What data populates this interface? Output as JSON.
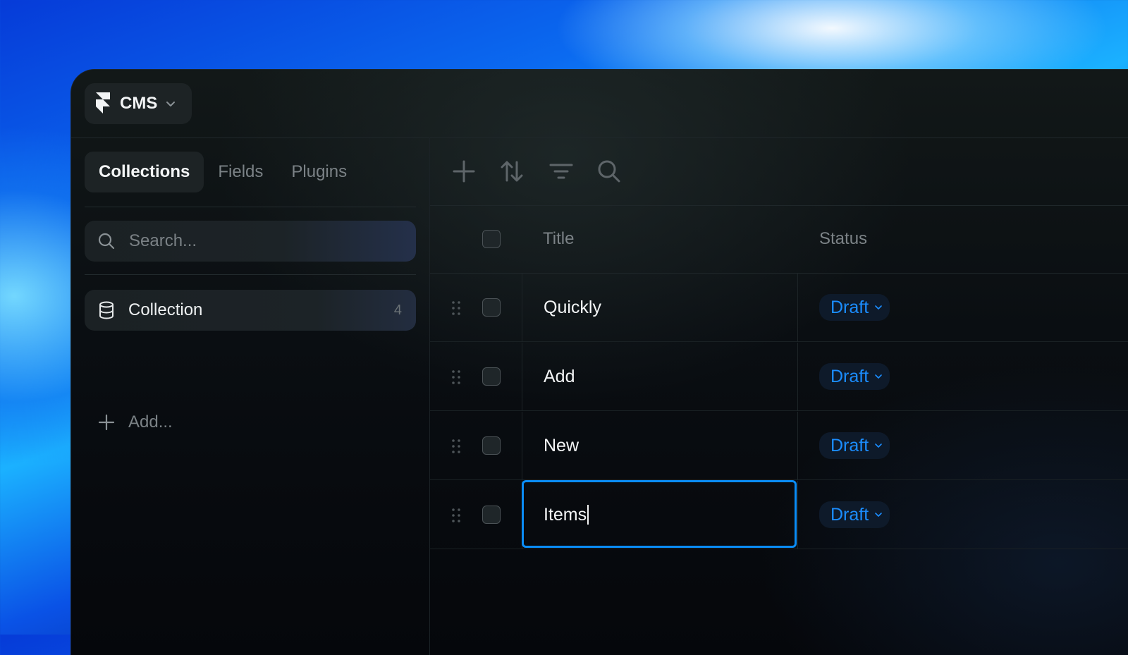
{
  "app": {
    "name": "CMS",
    "logo_icon": "framer-logo-icon"
  },
  "sidebar": {
    "tabs": [
      {
        "label": "Collections",
        "active": true
      },
      {
        "label": "Fields",
        "active": false
      },
      {
        "label": "Plugins",
        "active": false
      }
    ],
    "search": {
      "placeholder": "Search...",
      "value": ""
    },
    "collections": [
      {
        "label": "Collection",
        "count": "4"
      }
    ],
    "add_label": "Add..."
  },
  "toolbar": {
    "icons": [
      "plus-icon",
      "sort-icon",
      "filter-icon",
      "search-icon"
    ]
  },
  "table": {
    "columns": {
      "title": "Title",
      "status": "Status"
    },
    "rows": [
      {
        "title": "Quickly",
        "status": "Draft",
        "editing": false
      },
      {
        "title": "Add",
        "status": "Draft",
        "editing": false
      },
      {
        "title": "New",
        "status": "Draft",
        "editing": false
      },
      {
        "title": "Items",
        "status": "Draft",
        "editing": true
      }
    ]
  },
  "colors": {
    "accent": "#0a8cf5",
    "status_text": "#1b8dff",
    "background": "#0a0e12"
  }
}
